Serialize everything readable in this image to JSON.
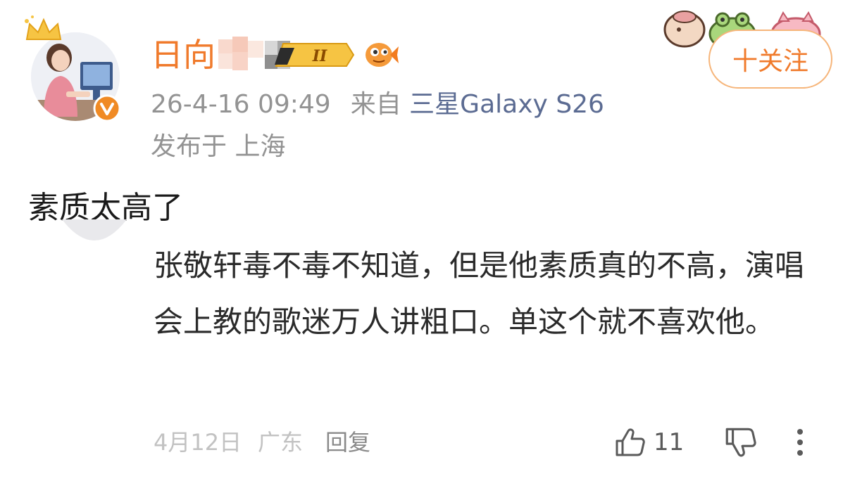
{
  "post": {
    "username": "日向",
    "timestamp": "26-4-16 09:49",
    "source_prefix": "来自",
    "device": "三星Galaxy S26",
    "location": "发布于 上海",
    "follow_label": "十关注",
    "text": "素质太高了",
    "level_badge": "II"
  },
  "comment": {
    "text": "张敬轩毒不毒不知道，但是他素质真的不高，演唱会上教的歌迷万人讲粗口。单这个就不喜欢他。",
    "date": "4月12日",
    "region": "广东",
    "reply_label": "回复",
    "like_count": "11"
  },
  "icons": {
    "verified": "verified-v-badge-icon",
    "crown": "crown-icon",
    "fish": "fish-icon",
    "like": "thumbs-up-icon",
    "dislike": "thumbs-down-icon",
    "more": "more-vertical-icon"
  },
  "colors": {
    "accent": "#f07a2b",
    "device_link": "#5b6b92",
    "meta": "#939393",
    "footer": "#c2c2c2"
  }
}
